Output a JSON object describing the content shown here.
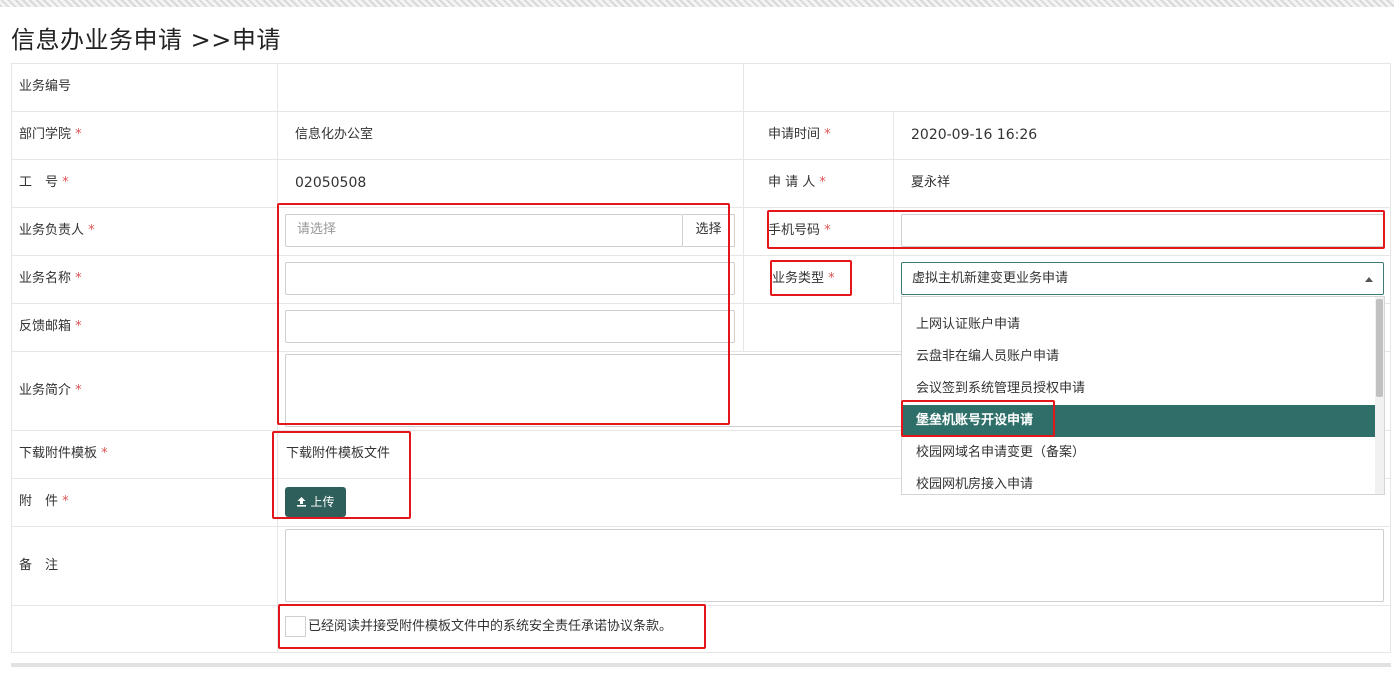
{
  "page": {
    "title": "信息办业务申请 >>申请"
  },
  "form": {
    "business_no_label": "业务编号",
    "department_label": "部门学院",
    "department_value": "信息化办公室",
    "apply_time_label": "申请时间",
    "apply_time_value": "2020-09-16 16:26",
    "staff_no_label": "工　号",
    "staff_no_value": "02050508",
    "applicant_label": "申 请 人",
    "applicant_value": "夏永祥",
    "owner_label": "业务负责人",
    "owner_placeholder": "请选择",
    "owner_select_button": "选择",
    "phone_label": "手机号码",
    "phone_value": "",
    "name_label": "业务名称",
    "name_value": "",
    "type_label": "业务类型",
    "type_selected": "虚拟主机新建变更业务申请",
    "type_options": [
      "上网认证账户申请",
      "云盘非在编人员账户申请",
      "会议签到系统管理员授权申请",
      "堡垒机账号开设申请",
      "校园网域名申请变更（备案）",
      "校园网机房接入申请"
    ],
    "type_highlighted_index": 3,
    "email_label": "反馈邮箱",
    "email_value": "",
    "summary_label": "业务简介",
    "summary_value": "",
    "template_label": "下载附件模板",
    "template_link": "下载附件模板文件",
    "attachment_label": "附　件",
    "upload_button": "上传",
    "remark_label": "备　注",
    "remark_value": "",
    "agree_text": "已经阅读并接受附件模板文件中的系统安全责任承诺协议条款。",
    "agree_checked": false,
    "required_mark": "*"
  },
  "colors": {
    "accent": "#2f6f6a",
    "required": "#d9534f",
    "highlight_box": "#e4161a"
  },
  "icons": {
    "upload": "upload-icon",
    "dropdown_caret": "caret-up-icon"
  }
}
